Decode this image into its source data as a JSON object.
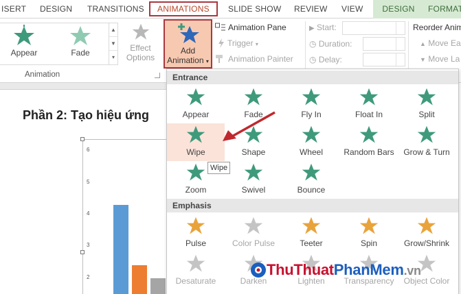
{
  "tabs": [
    {
      "label": "ISERT",
      "active": false
    },
    {
      "label": "DESIGN",
      "active": false
    },
    {
      "label": "TRANSITIONS",
      "active": false
    },
    {
      "label": "ANIMATIONS",
      "active": true
    },
    {
      "label": "SLIDE SHOW",
      "active": false
    },
    {
      "label": "REVIEW",
      "active": false
    },
    {
      "label": "VIEW",
      "active": false
    },
    {
      "label": "DESIGN",
      "contextual": true
    },
    {
      "label": "FORMAT",
      "contextual": true
    }
  ],
  "ribbon": {
    "gallery": [
      {
        "label": "Appear"
      },
      {
        "label": "Fade"
      }
    ],
    "animation_group_label": "Animation",
    "effect_options": {
      "line1": "Effect",
      "line2": "Options"
    },
    "add_animation": {
      "line1": "Add",
      "line2": "Animation"
    },
    "animation_pane": "Animation Pane",
    "trigger": "Trigger",
    "animation_painter": "Animation Painter",
    "start_label": "Start:",
    "duration_label": "Duration:",
    "delay_label": "Delay:",
    "reorder_label": "Reorder Anim",
    "move_earlier": "Move Ea",
    "move_later": "Move La"
  },
  "slide": {
    "heading": "Phần 2: Tạo hiệu ứng",
    "chart_data": {
      "type": "bar",
      "y_ticks": [
        "6",
        "5",
        "4",
        "3",
        "2"
      ],
      "ylim": [
        1.5,
        6
      ],
      "series": [
        {
          "value": 4.3,
          "color": "#5b9bd5"
        },
        {
          "value": 2.4,
          "color": "#ed7d31"
        },
        {
          "value": 2.0,
          "color": "#a5a5a5"
        }
      ]
    }
  },
  "panel": {
    "entrance_label": "Entrance",
    "entrance": [
      {
        "label": "Appear",
        "icon": "appear-star-icon",
        "dim": false
      },
      {
        "label": "Fade",
        "icon": "fade-star-icon",
        "dim": false
      },
      {
        "label": "Fly In",
        "icon": "fly-in-star-icon",
        "dim": false
      },
      {
        "label": "Float In",
        "icon": "float-in-star-icon",
        "dim": false
      },
      {
        "label": "Split",
        "icon": "split-star-icon",
        "dim": false
      },
      {
        "label": "Wipe",
        "icon": "wipe-star-icon",
        "dim": false,
        "hot": true
      },
      {
        "label": "Shape",
        "icon": "shape-star-icon",
        "dim": false
      },
      {
        "label": "Wheel",
        "icon": "wheel-star-icon",
        "dim": false
      },
      {
        "label": "Random Bars",
        "icon": "random-bars-star-icon",
        "dim": false
      },
      {
        "label": "Grow & Turn",
        "icon": "grow-turn-star-icon",
        "dim": false
      },
      {
        "label": "Zoom",
        "icon": "zoom-star-icon",
        "dim": false
      },
      {
        "label": "Swivel",
        "icon": "swivel-star-icon",
        "dim": false
      },
      {
        "label": "Bounce",
        "icon": "bounce-star-icon",
        "dim": false
      }
    ],
    "emphasis_label": "Emphasis",
    "emphasis": [
      {
        "label": "Pulse",
        "icon": "pulse-star-icon",
        "dim": false
      },
      {
        "label": "Color Pulse",
        "icon": "color-pulse-star-icon",
        "dim": true
      },
      {
        "label": "Teeter",
        "icon": "teeter-star-icon",
        "dim": false
      },
      {
        "label": "Spin",
        "icon": "spin-star-icon",
        "dim": false
      },
      {
        "label": "Grow/Shrink",
        "icon": "grow-shrink-star-icon",
        "dim": false
      },
      {
        "label": "Desaturate",
        "icon": "desaturate-star-icon",
        "dim": true
      },
      {
        "label": "Darken",
        "icon": "darken-star-icon",
        "dim": true
      },
      {
        "label": "Lighten",
        "icon": "lighten-star-icon",
        "dim": true
      },
      {
        "label": "Transparency",
        "icon": "transparency-star-icon",
        "dim": true
      },
      {
        "label": "Object Color",
        "icon": "object-color-star-icon",
        "dim": true
      }
    ],
    "tooltip": "Wipe"
  },
  "colors": {
    "entrance_star": "#3f9a7c",
    "entrance_star_light": "#8fcbb3",
    "emphasis_star": "#e9a33b",
    "dim_star": "#c4c4c4",
    "accent_border": "#a9363e"
  },
  "watermark": {
    "part1": "ThuThuat",
    "part2": "PhanMem",
    "part3": ".vn"
  }
}
